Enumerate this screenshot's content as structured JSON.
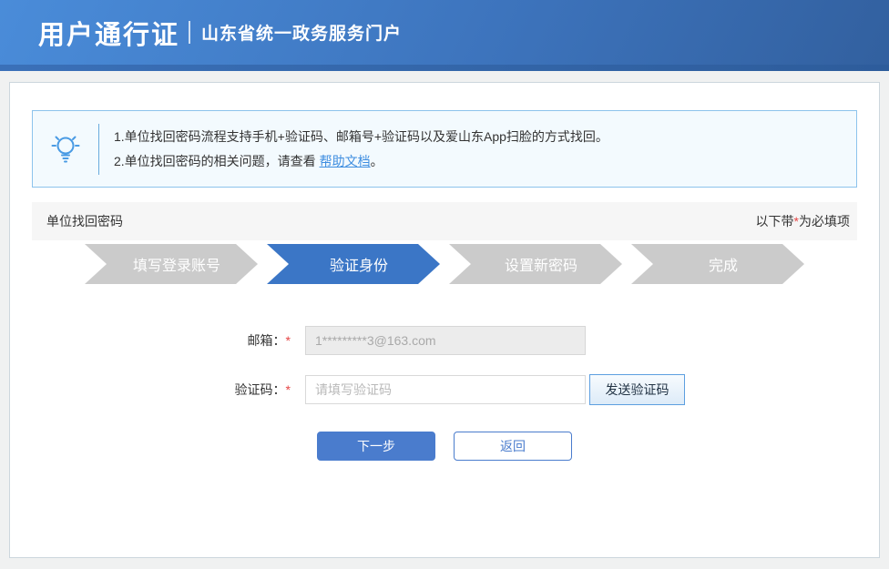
{
  "header": {
    "title": "用户通行证",
    "subtitle": "山东省统一政务服务门户"
  },
  "notice": {
    "line1": "1.单位找回密码流程支持手机+验证码、邮箱号+验证码以及爱山东App扫脸的方式找回。",
    "line2_prefix": "2.单位找回密码的相关问题，请查看 ",
    "help_link": "帮助文档",
    "line2_suffix": "。"
  },
  "section": {
    "title": "单位找回密码",
    "required_prefix": "以下带",
    "required_star": "*",
    "required_suffix": "为必填项"
  },
  "steps": [
    {
      "label": "填写登录账号",
      "active": false
    },
    {
      "label": "验证身份",
      "active": true
    },
    {
      "label": "设置新密码",
      "active": false
    },
    {
      "label": "完成",
      "active": false
    }
  ],
  "form": {
    "email_label": "邮箱：",
    "email_required": "*",
    "email_value": "1*********3@163.com",
    "code_label": "验证码：",
    "code_required": "*",
    "code_placeholder": "请填写验证码",
    "send_code_label": "发送验证码"
  },
  "actions": {
    "next_label": "下一步",
    "back_label": "返回"
  },
  "colors": {
    "header_gradient_start": "#4a8cd9",
    "header_gradient_end": "#32609f",
    "header_strip": "#2d5c9b",
    "notice_border": "#8cc3ec",
    "notice_bg": "#f3fafe",
    "link": "#3f8ee0",
    "step_active": "#3b76c6",
    "step_inactive": "#cbcbcb",
    "primary_button": "#4a7ccd",
    "required_mark": "#e64545"
  }
}
